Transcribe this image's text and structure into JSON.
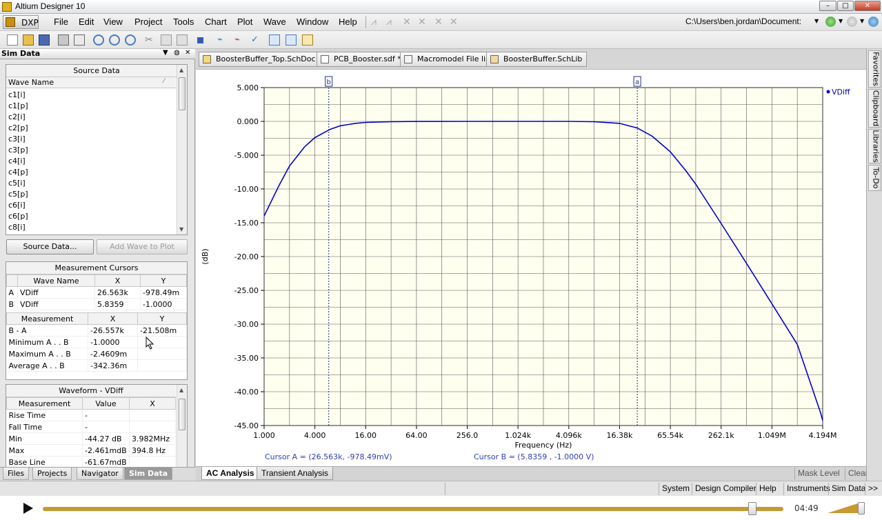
{
  "window": {
    "title": "Altium Designer 10",
    "controls": [
      "–",
      "□",
      "✕"
    ]
  },
  "menu": {
    "dxp": "DXP",
    "items": [
      "File",
      "Edit",
      "View",
      "Project",
      "Tools",
      "Chart",
      "Plot",
      "Wave",
      "Window",
      "Help"
    ],
    "path": "C:\\Users\\ben.jordan\\Document:"
  },
  "panel": {
    "title": "Sim Data",
    "source": {
      "title": "Source Data",
      "column": "Wave Name",
      "waves": [
        "c1[i]",
        "c1[p]",
        "c2[i]",
        "c2[p]",
        "c3[i]",
        "c3[p]",
        "c4[i]",
        "c4[p]",
        "c5[i]",
        "c5[p]",
        "c6[i]",
        "c6[p]",
        "c8[i]"
      ]
    },
    "buttons": {
      "source_data": "Source Data...",
      "add_wave": "Add Wave to Plot"
    },
    "cursors": {
      "title": "Measurement Cursors",
      "headers": [
        "",
        "Wave Name",
        "X",
        "Y"
      ],
      "rows": [
        [
          "A",
          "VDiff",
          "26.563k",
          "-978.49m"
        ],
        [
          "B",
          "VDiff",
          "5.8359",
          "-1.0000"
        ]
      ],
      "meas_headers": [
        "Measurement",
        "X",
        "Y"
      ],
      "meas_rows": [
        [
          "B - A",
          "-26.557k",
          "-21.508m"
        ],
        [
          "Minimum  A . . B",
          "-1.0000",
          ""
        ],
        [
          "Maximum  A . . B",
          "-2.4609m",
          ""
        ],
        [
          "Average  A . . B",
          "-342.36m",
          ""
        ]
      ]
    },
    "waveform": {
      "title": "Waveform - VDiff",
      "headers": [
        "Measurement",
        "Value",
        "X"
      ],
      "rows": [
        [
          "Rise Time",
          "-",
          ""
        ],
        [
          "Fall Time",
          "-",
          ""
        ],
        [
          "Min",
          "-44.27 dB",
          "3.982MHz"
        ],
        [
          "Max",
          "-2.461mdB",
          "394.8 Hz"
        ],
        [
          "Base Line",
          "-61.67mdB",
          ""
        ]
      ]
    },
    "tabs": [
      "Files",
      "Projects",
      "Navigator",
      "Sim Data"
    ],
    "active_tab": "Sim Data"
  },
  "doc_tabs": [
    "BoosterBuffer_Top.SchDoc *",
    "PCB_Booster.sdf *",
    "Macromodel File list",
    "BoosterBuffer.SchLib"
  ],
  "right_tabs": [
    "Favorites",
    "Clipboard",
    "Libraries",
    "To-Do"
  ],
  "chart_tabs": [
    "AC Analysis",
    "Transient Analysis"
  ],
  "chart_buttons": [
    "Mask Level",
    "Clear"
  ],
  "status_buttons": [
    "System",
    "Design Compiler",
    "Help",
    "Instruments",
    "Sim Data",
    ">>"
  ],
  "player": {
    "time": "04:49",
    "progress": 0.96,
    "volume": 0.9
  },
  "colors": {
    "plot_bg": "#fffff0",
    "trace": "#0000c8",
    "grid": "#333333",
    "accent": "#c69a32"
  },
  "chart_data": {
    "type": "line",
    "xlabel": "Frequency (Hz)",
    "ylabel": "(dB)",
    "xscale": "log2",
    "xticks": [
      "1.000",
      "4.000",
      "16.00",
      "64.00",
      "256.0",
      "1.024k",
      "4.096k",
      "16.38k",
      "65.54k",
      "262.1k",
      "1.049M",
      "4.194M"
    ],
    "yticks": [
      "5.000",
      "0.000",
      "-5.000",
      "-10.00",
      "-15.00",
      "-20.00",
      "-25.00",
      "-30.00",
      "-35.00",
      "-40.00",
      "-45.00"
    ],
    "xlim": [
      1,
      4194304
    ],
    "ylim": [
      -45,
      5
    ],
    "series": [
      {
        "name": "VDiff",
        "x": [
          1,
          1.5,
          2,
          3,
          4,
          6,
          8,
          12,
          16,
          32,
          64,
          256,
          1024,
          4096,
          8192,
          16384,
          26563,
          40000,
          65536,
          100000,
          131072,
          262144,
          524288,
          1048576,
          2097152,
          3982000,
          4194304
        ],
        "y": [
          -14,
          -9.5,
          -6.6,
          -3.8,
          -2.4,
          -1.2,
          -0.65,
          -0.3,
          -0.15,
          -0.04,
          -0.01,
          0,
          0,
          0,
          -0.05,
          -0.3,
          -0.98,
          -2.2,
          -4.5,
          -7.3,
          -9.3,
          -15.1,
          -21.0,
          -27.0,
          -33.0,
          -43.2,
          -44.27
        ]
      }
    ],
    "cursors": [
      {
        "label": "b",
        "x": 5.8359
      },
      {
        "label": "a",
        "x": 26563
      }
    ],
    "cursor_text": {
      "a": "Cursor A = (26.563k, -978.49mV)",
      "b": "Cursor B = (5.8359 , -1.0000 V)"
    },
    "legend": "top-right",
    "grid": true
  }
}
